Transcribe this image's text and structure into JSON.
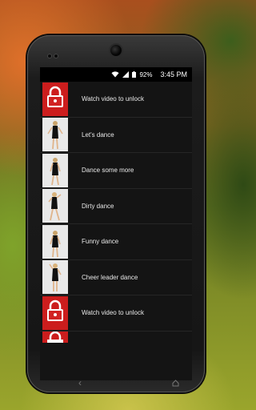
{
  "status": {
    "battery_percent": "92%",
    "time": "3:45 PM"
  },
  "list": {
    "items": [
      {
        "label": "Watch video to unlock",
        "locked": true
      },
      {
        "label": "Let's dance",
        "locked": false
      },
      {
        "label": "Dance some more",
        "locked": false
      },
      {
        "label": "Dirty dance",
        "locked": false
      },
      {
        "label": "Funny dance",
        "locked": false
      },
      {
        "label": "Cheer leader dance",
        "locked": false
      },
      {
        "label": "Watch video to unlock",
        "locked": true
      }
    ]
  },
  "nav": {
    "back_icon": "back-arrow-icon",
    "home_icon": "home-icon"
  },
  "colors": {
    "lock_background": "#cc1d1d",
    "row_background": "#141414",
    "text": "#e8e8e8"
  }
}
